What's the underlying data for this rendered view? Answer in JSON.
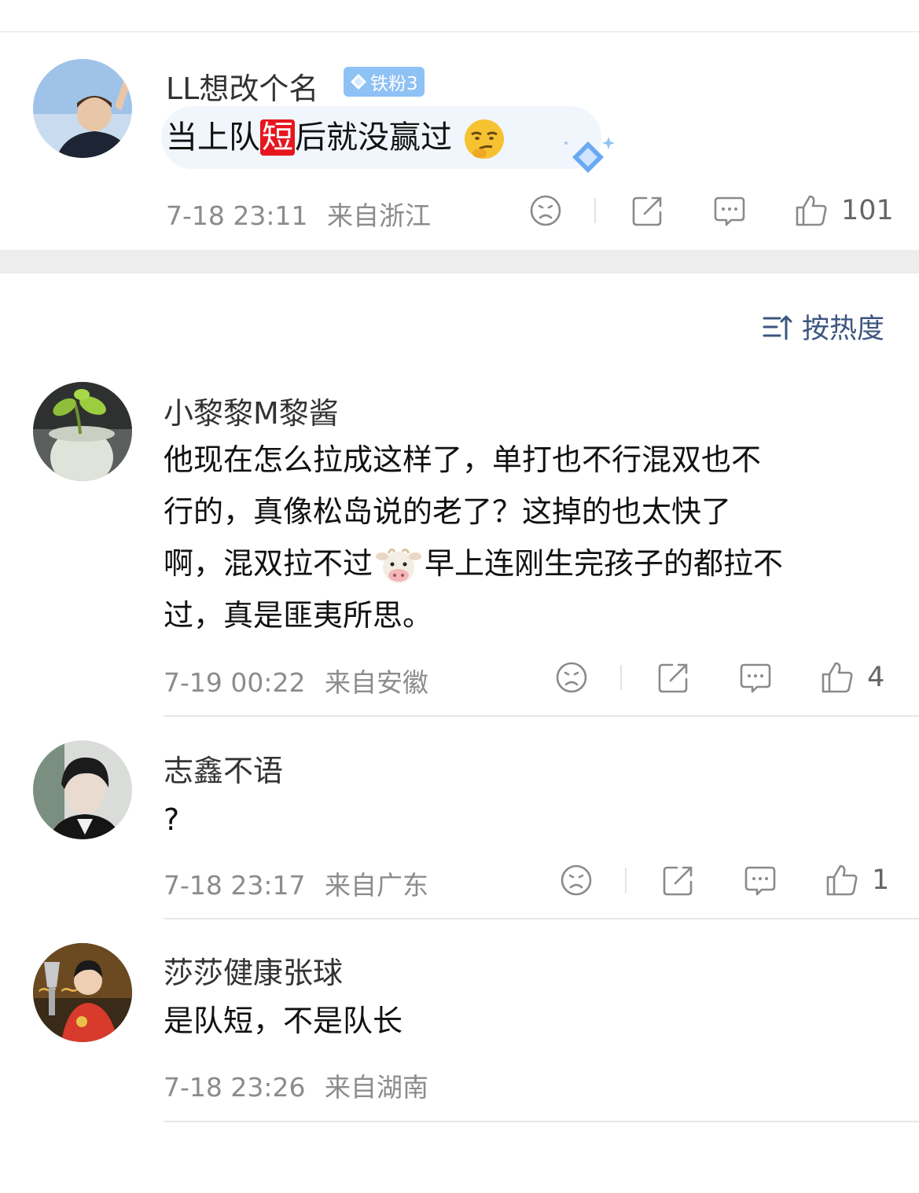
{
  "pinned": {
    "username": "LL想改个名",
    "fan_badge": "铁粉3",
    "text_before": "当上队",
    "tag_text": "短",
    "text_after": "后就没赢过",
    "emoji": "smirk-emoji",
    "time": "7-18 23:11",
    "location": "来自浙江",
    "like_count": "101"
  },
  "sort": {
    "label": "按热度",
    "icon": "sort-icon"
  },
  "comments": [
    {
      "username": "小黎黎M黎酱",
      "line1": "他现在怎么拉成这样了，单打也不行混双也不",
      "line2": "行的，真像松岛说的老了？这掉的也太快了",
      "line3_before": "啊，混双拉不过",
      "emoji": "cow-emoji",
      "line3_after": "早上连刚生完孩子的都拉不",
      "line4": "过，真是匪夷所思。",
      "time": "7-19 00:22",
      "location": "来自安徽",
      "like_count": "4"
    },
    {
      "username": "志鑫不语",
      "text": "?",
      "time": "7-18 23:17",
      "location": "来自广东",
      "like_count": "1"
    },
    {
      "username": "莎莎健康张球",
      "text": "是队短，不是队长",
      "time": "7-18 23:26",
      "location": "来自湖南"
    }
  ],
  "icons": {
    "dislike": "sad-face-icon",
    "share": "share-icon",
    "reply": "comment-icon",
    "like": "thumbs-up-icon"
  },
  "colors": {
    "badge": "#8ec1f4",
    "tag": "#e6161e",
    "sort_text": "#3d5680",
    "meta": "#8c8c8c"
  }
}
